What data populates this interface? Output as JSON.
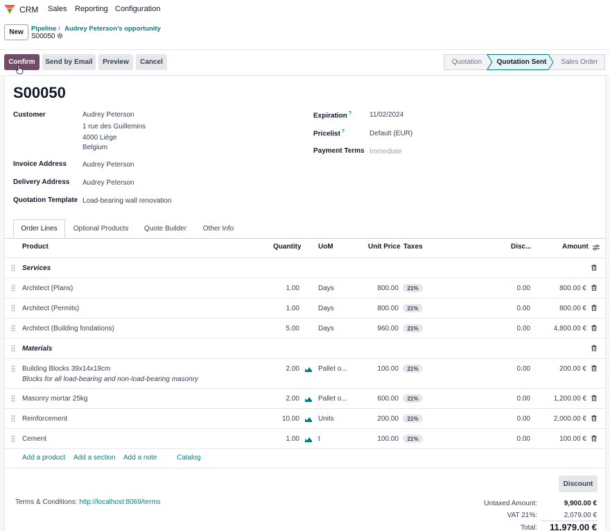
{
  "nav": {
    "app": "CRM",
    "menus": [
      "Sales",
      "Reporting",
      "Configuration"
    ]
  },
  "control": {
    "new_label": "New",
    "breadcrumb": [
      "Pipeline",
      "Audrey Peterson's opportunity"
    ],
    "record": "S00050"
  },
  "actions": {
    "confirm": "Confirm",
    "send": "Send by Email",
    "preview": "Preview",
    "cancel": "Cancel"
  },
  "statusbar": {
    "steps": [
      "Quotation",
      "Quotation Sent",
      "Sales Order"
    ],
    "current": "Quotation Sent"
  },
  "form": {
    "title": "S00050",
    "customer_label": "Customer",
    "customer_lines": [
      "Audrey Peterson",
      "1 rue des Guillemins",
      "4000 Liège",
      "Belgium"
    ],
    "invoice_label": "Invoice Address",
    "invoice_value": "Audrey Peterson",
    "delivery_label": "Delivery Address",
    "delivery_value": "Audrey Peterson",
    "template_label": "Quotation Template",
    "template_value": "Load-bearing wall renovation",
    "expiration_label": "Expiration",
    "expiration_value": "11/02/2024",
    "pricelist_label": "Pricelist",
    "pricelist_value": "Default (EUR)",
    "terms_label": "Payment Terms",
    "terms_value": "Immediate",
    "help_mark": "?"
  },
  "tabs": [
    "Order Lines",
    "Optional Products",
    "Quote Builder",
    "Other Info"
  ],
  "table": {
    "headers": {
      "product": "Product",
      "quantity": "Quantity",
      "uom": "UoM",
      "unit_price": "Unit Price",
      "taxes": "Taxes",
      "disc": "Disc...",
      "amount": "Amount"
    },
    "lines": [
      {
        "kind": "section",
        "name": "Services"
      },
      {
        "kind": "line",
        "name": "Architect (Plans)",
        "qty": "1.00",
        "uom": "Days",
        "price": "800.00",
        "tax": "21%",
        "disc": "0.00",
        "amount": "800.00 €"
      },
      {
        "kind": "line",
        "name": "Architect (Permits)",
        "qty": "1.00",
        "uom": "Days",
        "price": "800.00",
        "tax": "21%",
        "disc": "0.00",
        "amount": "800.00 €"
      },
      {
        "kind": "line",
        "name": "Architect (Building fondations)",
        "qty": "5.00",
        "uom": "Days",
        "price": "960.00",
        "tax": "21%",
        "disc": "0.00",
        "amount": "4,800.00 €"
      },
      {
        "kind": "section",
        "name": "Materials"
      },
      {
        "kind": "line",
        "name": "Building Blocks 39x14x19cm",
        "note": "Blocks for all load-bearing and non-load-bearing masonry",
        "qty": "2.00",
        "uom": "Pallet o...",
        "price": "100.00",
        "tax": "21%",
        "disc": "0.00",
        "amount": "200.00 €",
        "forecast": true
      },
      {
        "kind": "line",
        "name": "Masonry mortar 25kg",
        "qty": "2.00",
        "uom": "Pallet o...",
        "price": "600.00",
        "tax": "21%",
        "disc": "0.00",
        "amount": "1,200.00 €",
        "forecast": true
      },
      {
        "kind": "line",
        "name": "Reinforcement",
        "qty": "10.00",
        "uom": "Units",
        "price": "200.00",
        "tax": "21%",
        "disc": "0.00",
        "amount": "2,000.00 €",
        "forecast": true
      },
      {
        "kind": "line",
        "name": "Cement",
        "qty": "1.00",
        "uom": "t",
        "price": "100.00",
        "tax": "21%",
        "disc": "0.00",
        "amount": "100.00 €",
        "forecast": true
      }
    ],
    "links": [
      "Add a product",
      "Add a section",
      "Add a note",
      "Catalog"
    ]
  },
  "footer": {
    "discount_btn": "Discount",
    "terms_prefix": "Terms & Conditions: ",
    "terms_link": "http://localhost:8069/terms",
    "untaxed_label": "Untaxed Amount:",
    "untaxed_value": "9,900.00 €",
    "vat_label": "VAT 21%:",
    "vat_value": "2,079.00 €",
    "total_label": "Total:",
    "total_value": "11,979.00 €"
  },
  "colors": {
    "brand": "#714b67",
    "link": "#017e84",
    "status_active": "#e6f4f4"
  }
}
